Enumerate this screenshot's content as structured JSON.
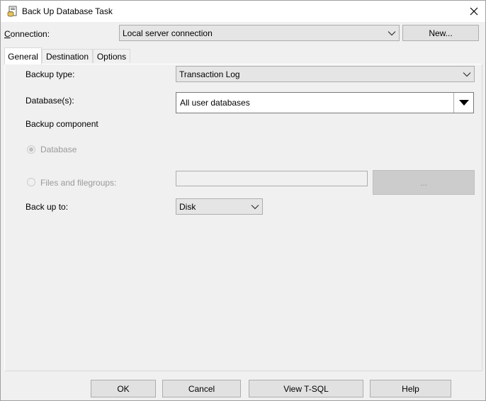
{
  "window": {
    "title": "Back Up Database Task",
    "title_icon": "database-task-icon",
    "close_icon": "close-icon"
  },
  "connection": {
    "label": "Connection:",
    "value": "Local server connection",
    "new_button": "New..."
  },
  "tabs": [
    {
      "label": "General",
      "active": true
    },
    {
      "label": "Destination",
      "active": false
    },
    {
      "label": "Options",
      "active": false
    }
  ],
  "general": {
    "backup_type_label": "Backup type:",
    "backup_type_value": "Transaction Log",
    "databases_label": "Database(s):",
    "databases_value": "All user databases",
    "backup_component_label": "Backup component",
    "database_option": "Database",
    "files_option": "Files and filegroups:",
    "files_value": "",
    "ellipsis_button": "...",
    "back_up_to_label": "Back up to:",
    "back_up_to_value": "Disk"
  },
  "footer": {
    "ok": "OK",
    "cancel": "Cancel",
    "view_tsql": "View T-SQL",
    "help": "Help"
  }
}
